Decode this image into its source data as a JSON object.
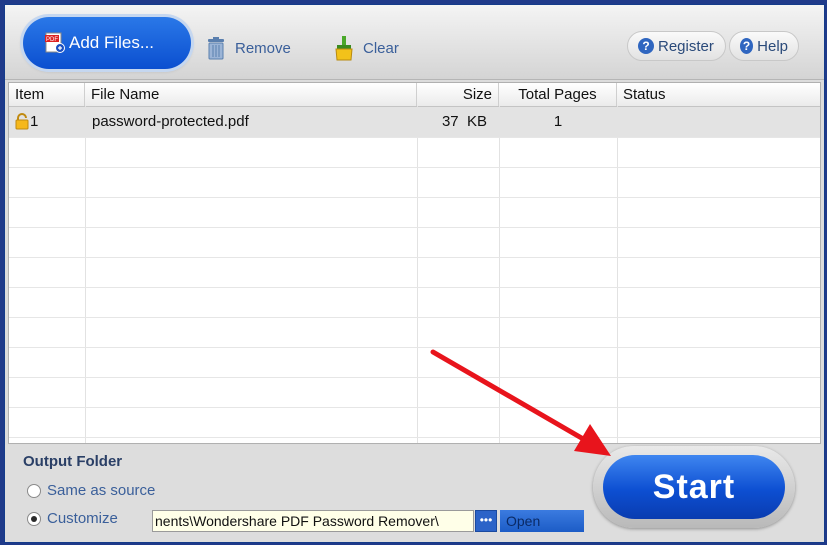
{
  "toolbar": {
    "add_files_label": "Add Files...",
    "remove_label": "Remove",
    "clear_label": "Clear",
    "register_label": "Register",
    "help_label": "Help"
  },
  "table": {
    "headers": [
      "Item",
      "File Name",
      "Size",
      "Total Pages",
      "Status"
    ],
    "rows": [
      {
        "item": "1",
        "file_name": "password-protected.pdf",
        "size": "37  KB",
        "total_pages": "1",
        "status": ""
      }
    ]
  },
  "output": {
    "title": "Output Folder",
    "option_same": "Same as source",
    "option_custom": "Customize",
    "path_value": "nents\\Wondershare PDF Password Remover\\",
    "browse_label": "•••",
    "open_label": "Open",
    "selected": "Customize"
  },
  "start_label": "Start",
  "colors": {
    "arrow": "#e8141c",
    "accent": "#0d4fd2"
  }
}
